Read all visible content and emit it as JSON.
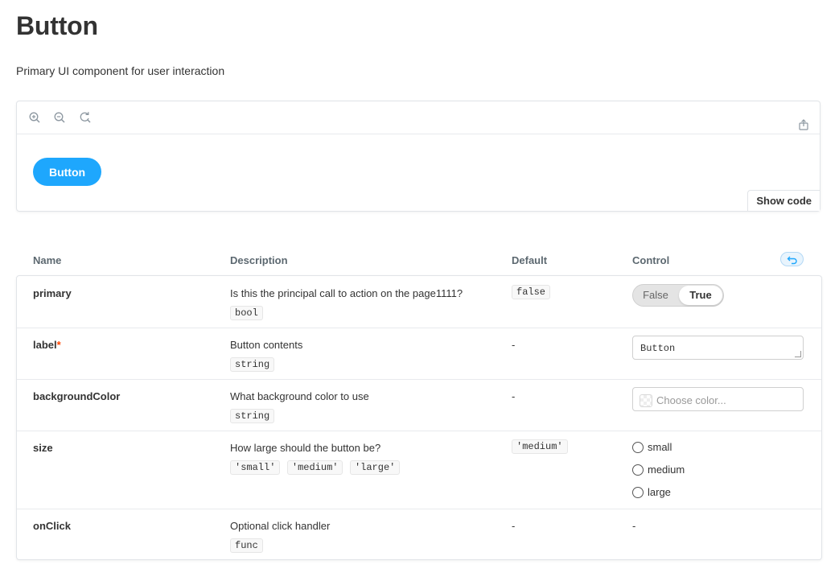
{
  "page": {
    "title": "Button",
    "subtitle": "Primary UI component for user interaction"
  },
  "preview": {
    "toolbar": {
      "tools": [
        "zoom-in-icon",
        "zoom-out-icon",
        "reset-zoom-icon"
      ],
      "share": "share-icon"
    },
    "button_label": "Button",
    "button_color": "#1ea7fd",
    "show_code_label": "Show code"
  },
  "args_table": {
    "headers": {
      "name": "Name",
      "description": "Description",
      "default": "Default",
      "control": "Control"
    },
    "reset_icon": "undo-icon",
    "rows": [
      {
        "name": "primary",
        "description": "Is this the principal call to action on the page1111?",
        "types": [
          "bool"
        ],
        "default": "false",
        "control": {
          "type": "toggle",
          "options": [
            "False",
            "True"
          ],
          "selected": "True"
        }
      },
      {
        "name": "label",
        "required_mark": "*",
        "description": "Button contents",
        "types": [
          "string"
        ],
        "default": "-",
        "control": {
          "type": "text",
          "value": "Button"
        }
      },
      {
        "name": "backgroundColor",
        "description": "What background color to use",
        "types": [
          "string"
        ],
        "default": "-",
        "control": {
          "type": "color",
          "placeholder": "Choose color..."
        }
      },
      {
        "name": "size",
        "description": "How large should the button be?",
        "types": [
          "'small'",
          "'medium'",
          "'large'"
        ],
        "default": "'medium'",
        "control": {
          "type": "radio",
          "options": [
            "small",
            "medium",
            "large"
          ]
        }
      },
      {
        "name": "onClick",
        "description": "Optional click handler",
        "types": [
          "func"
        ],
        "default": "-",
        "control": {
          "type": "none",
          "text": "-"
        }
      }
    ]
  }
}
